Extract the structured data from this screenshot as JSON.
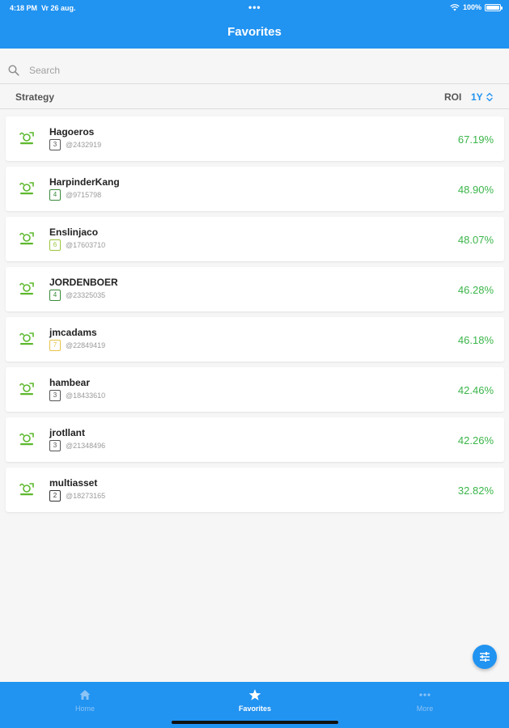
{
  "status_bar": {
    "time": "4:18 PM",
    "date": "Vr 26 aug.",
    "dots": "•••",
    "battery": "100%"
  },
  "header": {
    "title": "Favorites"
  },
  "search": {
    "placeholder": "Search"
  },
  "columns": {
    "strategy": "Strategy",
    "roi": "ROI",
    "period": "1Y"
  },
  "strategies": [
    {
      "name": "Hagoeros",
      "rank": "3",
      "rank_color": "#555555",
      "id": "@2432919",
      "roi": "67.19%"
    },
    {
      "name": "HarpinderKang",
      "rank": "4",
      "rank_color": "#3a8a3a",
      "id": "@9715798",
      "roi": "48.90%"
    },
    {
      "name": "Enslinjaco",
      "rank": "6",
      "rank_color": "#9bc53d",
      "id": "@17603710",
      "roi": "48.07%"
    },
    {
      "name": "JORDENBOER",
      "rank": "4",
      "rank_color": "#3a8a3a",
      "id": "@23325035",
      "roi": "46.28%"
    },
    {
      "name": "jmcadams",
      "rank": "7",
      "rank_color": "#e6c34a",
      "id": "@22849419",
      "roi": "46.18%"
    },
    {
      "name": "hambear",
      "rank": "3",
      "rank_color": "#555555",
      "id": "@18433610",
      "roi": "42.46%"
    },
    {
      "name": "jrotllant",
      "rank": "3",
      "rank_color": "#555555",
      "id": "@21348496",
      "roi": "42.26%"
    },
    {
      "name": "multiasset",
      "rank": "2",
      "rank_color": "#333333",
      "id": "@18273165",
      "roi": "32.82%"
    }
  ],
  "tabs": {
    "home": "Home",
    "favorites": "Favorites",
    "more": "More"
  },
  "colors": {
    "primary": "#2193f1",
    "roi_green": "#3bb54a",
    "logo_green": "#5cb82c"
  },
  "icons": {
    "search": "search-icon",
    "sort": "sort-icon",
    "filter": "filter-icon",
    "home": "home-icon",
    "star": "star-icon",
    "more": "more-dots-icon",
    "logo": "etoro-logo-icon"
  }
}
